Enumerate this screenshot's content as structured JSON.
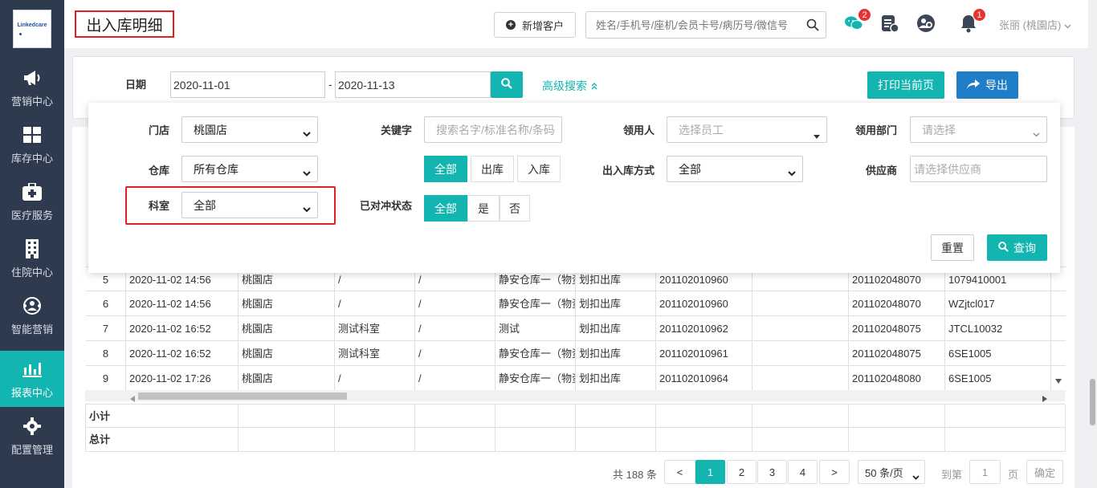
{
  "app": {
    "logo_text": "Linkedcare"
  },
  "sidebar": {
    "items": [
      {
        "label": "营销中心",
        "icon": "megaphone-icon"
      },
      {
        "label": "库存中心",
        "icon": "grid-icon"
      },
      {
        "label": "医疗服务",
        "icon": "medical-kit-icon"
      },
      {
        "label": "住院中心",
        "icon": "building-icon"
      },
      {
        "label": "智能营销",
        "icon": "smart-marketing-icon"
      },
      {
        "label": "报表中心",
        "icon": "bar-chart-icon"
      },
      {
        "label": "配置管理",
        "icon": "gear-icon"
      }
    ],
    "active_index": 5
  },
  "header": {
    "title": "出入库明细",
    "new_customer_label": "新增客户",
    "search_placeholder": "姓名/手机号/座机/会员卡号/病历号/微信号",
    "chat_badge": "2",
    "bell_badge": "1",
    "user": "张丽 (桃園店)"
  },
  "filter": {
    "date_label": "日期",
    "date_from": "2020-11-01",
    "date_sep": "-",
    "date_to": "2020-11-13",
    "advanced_label": "高级搜索",
    "print_label": "打印当前页",
    "export_label": "导出"
  },
  "advanced": {
    "store_label": "门店",
    "store_value": "桃園店",
    "keyword_label": "关键字",
    "keyword_placeholder": "搜索名字/标准名称/条码",
    "receiver_label": "领用人",
    "receiver_placeholder": "选择员工",
    "dept_label": "领用部门",
    "dept_placeholder": "请选择",
    "warehouse_label": "仓库",
    "warehouse_value": "所有仓库",
    "io_types": [
      "全部",
      "出库",
      "入库"
    ],
    "io_method_label": "出入库方式",
    "io_method_value": "全部",
    "supplier_label": "供应商",
    "supplier_placeholder": "请选择供应商",
    "room_label": "科室",
    "room_value": "全部",
    "offset_label": "已对冲状态",
    "offset_options": [
      "全部",
      "是",
      "否"
    ],
    "reset_label": "重置",
    "query_label": "查询"
  },
  "table": {
    "rows": [
      [
        "5",
        "2020-11-02 14:56",
        "桃園店",
        "/",
        "/",
        "静安仓库一（物资",
        "划扣出库",
        "201102010960",
        "",
        "201102048070",
        "1079410001"
      ],
      [
        "6",
        "2020-11-02 14:56",
        "桃園店",
        "/",
        "/",
        "静安仓库一（物资",
        "划扣出库",
        "201102010960",
        "",
        "201102048070",
        "WZjtcl017"
      ],
      [
        "7",
        "2020-11-02 16:52",
        "桃園店",
        "测试科室",
        "/",
        "测试",
        "划扣出库",
        "201102010962",
        "",
        "201102048075",
        "JTCL10032"
      ],
      [
        "8",
        "2020-11-02 16:52",
        "桃園店",
        "测试科室",
        "/",
        "静安仓库一（物资",
        "划扣出库",
        "201102010961",
        "",
        "201102048075",
        "6SE1005"
      ],
      [
        "9",
        "2020-11-02 17:26",
        "桃園店",
        "/",
        "/",
        "静安仓库一（物资",
        "划扣出库",
        "201102010964",
        "",
        "201102048080",
        "6SE1005"
      ]
    ],
    "subtotal_label": "小计",
    "total_label": "总计"
  },
  "pagination": {
    "total_text": "共 188 条",
    "prev": "<",
    "pages": [
      "1",
      "2",
      "3",
      "4"
    ],
    "current": "1",
    "next": ">",
    "page_size": "50 条/页",
    "goto_label": "到第",
    "goto_value": "1",
    "page_unit": "页",
    "confirm_label": "确定"
  }
}
